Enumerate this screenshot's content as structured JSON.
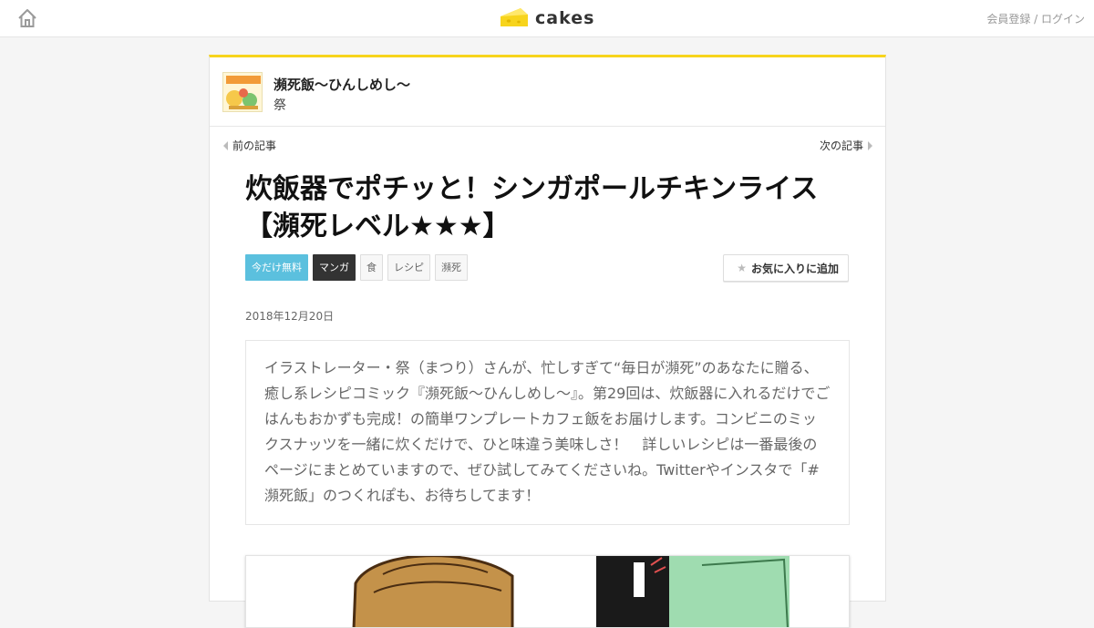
{
  "header": {
    "logo_text": "cakes",
    "auth_text": "会員登録 / ログイン",
    "accent_color": "#f7d41c"
  },
  "series": {
    "title": "瀕死飯～ひんしめし～",
    "author": "祭"
  },
  "pager": {
    "prev_label": "前の記事",
    "next_label": "次の記事"
  },
  "article": {
    "title": "炊飯器でポチッと！シンガポールチキンライス【瀕死レベル★★★】",
    "tags": [
      "今だけ無料",
      "マンガ",
      "食",
      "レシピ",
      "瀕死"
    ],
    "favorite_label": "お気に入りに追加",
    "date": "2018年12月20日",
    "lead": "イラストレーター・祭（まつり）さんが、忙しすぎて“毎日が瀕死”のあなたに贈る、癒し系レシピコミック『瀕死飯～ひんしめし～』。第29回は、炊飯器に入れるだけでごはんもおかずも完成！の簡単ワンプレートカフェ飯をお届けします。コンビニのミックスナッツを一緒に炊くだけで、ひと味違う美味しさ！　詳しいレシピは一番最後のページにまとめていますので、ぜひ試してみてくださいね。Twitterやインスタで「#瀕死飯」のつくれぽも、お待ちしてます！"
  },
  "icons": {
    "home": "home-icon",
    "logo": "cheese-logo-icon",
    "star": "star-icon",
    "prev": "arrow-left-icon",
    "next": "arrow-right-icon"
  }
}
